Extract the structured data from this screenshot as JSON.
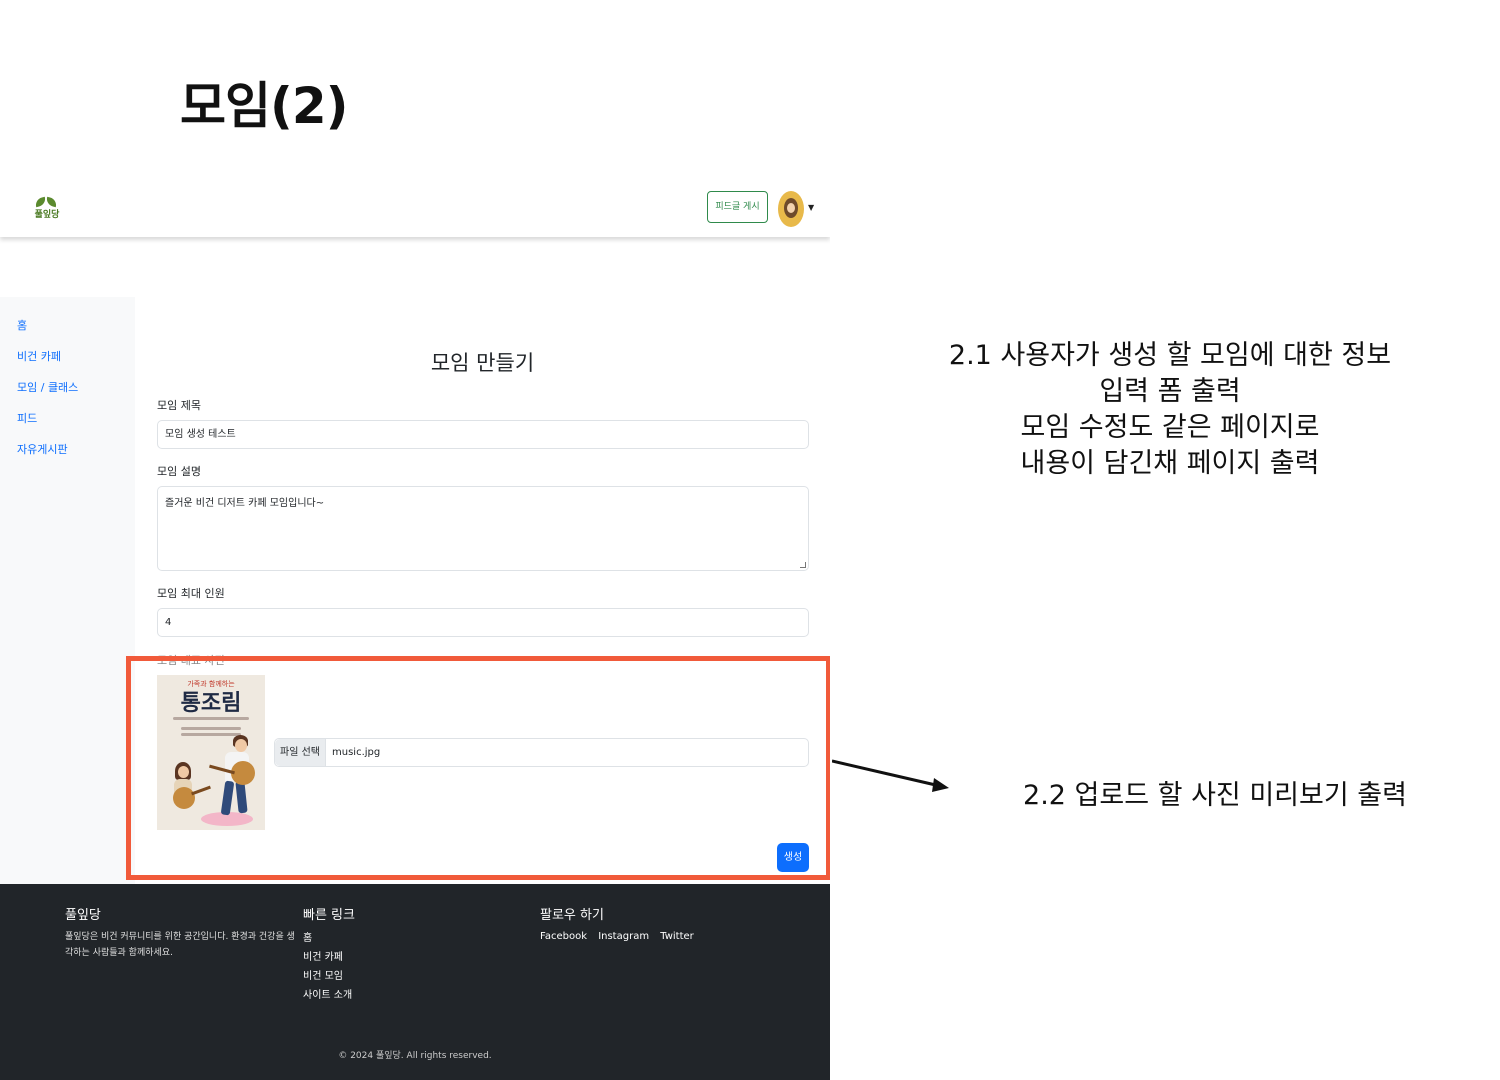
{
  "slide": {
    "title": "모임(2)"
  },
  "navbar": {
    "logo_text": "풀잎당",
    "feed_post_button": "피드글 게시"
  },
  "sidebar": {
    "items": [
      {
        "label": "홈"
      },
      {
        "label": "비건 카페"
      },
      {
        "label": "모임 / 클래스"
      },
      {
        "label": "피드"
      },
      {
        "label": "자유게시판"
      }
    ]
  },
  "form": {
    "title": "모임 만들기",
    "fields": {
      "title_label": "모임 제목",
      "title_value": "모임 생성 테스트",
      "desc_label": "모임 설명",
      "desc_value": "즐거운 비건 디저트 카페 모임입니다~",
      "max_label": "모임 최대 인원",
      "max_value": "4",
      "image_label": "모임 대표 사진"
    },
    "preview": {
      "small_text": "가족과 함께하는",
      "title": "통조림"
    },
    "file": {
      "button_label": "파일 선택",
      "file_name": "music.jpg"
    },
    "submit_label": "생성"
  },
  "footer": {
    "brand": "풀잎당",
    "description": "풀잎당은 비건 커뮤니티를 위한 공간입니다. 환경과 건강을 생각하는 사람들과 함께하세요.",
    "quick_links_title": "빠른 링크",
    "quick_links": [
      {
        "label": "홈"
      },
      {
        "label": "비건 카페"
      },
      {
        "label": "비건 모임"
      },
      {
        "label": "사이트 소개"
      }
    ],
    "follow_title": "팔로우 하기",
    "social": [
      {
        "label": "Facebook"
      },
      {
        "label": "Instagram"
      },
      {
        "label": "Twitter"
      }
    ],
    "copyright": "© 2024 풀잎당. All rights reserved."
  },
  "annotations": {
    "a1": [
      "2.1 사용자가 생성 할 모임에 대한 정보",
      "입력 폼 출력",
      "모임 수정도 같은 페이지로",
      "내용이 담긴채 페이지 출력"
    ],
    "a2": "2.2 업로드 할 사진 미리보기 출력"
  },
  "colors": {
    "highlight": "#f15a3a",
    "primary": "#0d6efd",
    "footer_bg": "#212529",
    "nav_button": "#2f8a4b"
  }
}
